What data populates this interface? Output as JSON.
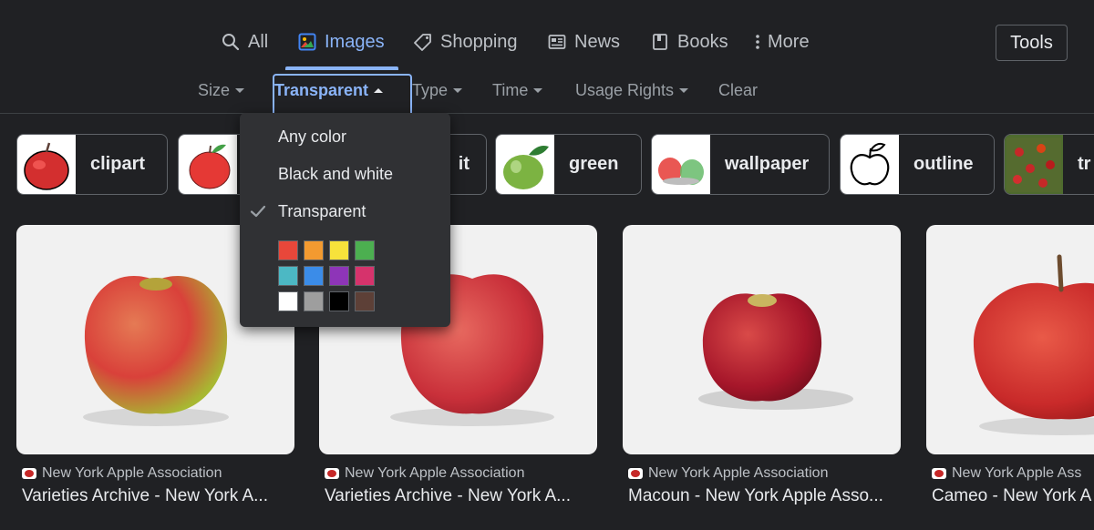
{
  "tabs": [
    {
      "label": "All",
      "icon": "search-icon"
    },
    {
      "label": "Images",
      "icon": "image-icon"
    },
    {
      "label": "Shopping",
      "icon": "tag-icon"
    },
    {
      "label": "News",
      "icon": "news-icon"
    },
    {
      "label": "Books",
      "icon": "book-icon"
    },
    {
      "label": "More",
      "icon": "more-vert-icon"
    }
  ],
  "active_tab": "Images",
  "tools_label": "Tools",
  "filters": [
    {
      "label": "Size"
    },
    {
      "label": "Transparent",
      "expanded": true
    },
    {
      "label": "Type"
    },
    {
      "label": "Time"
    },
    {
      "label": "Usage Rights"
    },
    {
      "label": "Clear"
    }
  ],
  "color_menu": {
    "options": [
      "Any color",
      "Black and white",
      "Transparent"
    ],
    "selected": "Transparent",
    "swatches": [
      "#e8473a",
      "#f39a30",
      "#f7e23b",
      "#4caf50",
      "#4cb8c4",
      "#3b8ce8",
      "#8e35b8",
      "#d6336c",
      "#ffffff",
      "#9e9e9e",
      "#000000",
      "#5d4037"
    ]
  },
  "chips": [
    {
      "label": "clipart"
    },
    {
      "label": ""
    },
    {
      "label": "it"
    },
    {
      "label": "green"
    },
    {
      "label": "wallpaper"
    },
    {
      "label": "outline"
    },
    {
      "label": "tr"
    }
  ],
  "results": [
    {
      "source": "New York Apple Association",
      "title": "Varieties Archive - New York A..."
    },
    {
      "source": "New York Apple Association",
      "title": "Varieties Archive - New York A..."
    },
    {
      "source": "New York Apple Association",
      "title": "Macoun - New York Apple Asso..."
    },
    {
      "source": "New York Apple Ass",
      "title": "Cameo - New York A"
    }
  ],
  "colors": {
    "background": "#202124",
    "accent": "#8ab4f8",
    "text": "#e8eaed",
    "muted": "#9aa0a6"
  }
}
